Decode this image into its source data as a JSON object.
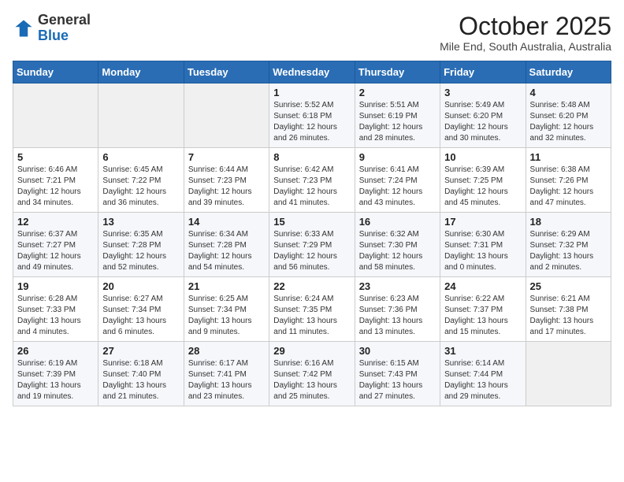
{
  "logo": {
    "general": "General",
    "blue": "Blue"
  },
  "header": {
    "month": "October 2025",
    "location": "Mile End, South Australia, Australia"
  },
  "weekdays": [
    "Sunday",
    "Monday",
    "Tuesday",
    "Wednesday",
    "Thursday",
    "Friday",
    "Saturday"
  ],
  "weeks": [
    [
      {
        "day": "",
        "info": ""
      },
      {
        "day": "",
        "info": ""
      },
      {
        "day": "",
        "info": ""
      },
      {
        "day": "1",
        "info": "Sunrise: 5:52 AM\nSunset: 6:18 PM\nDaylight: 12 hours\nand 26 minutes."
      },
      {
        "day": "2",
        "info": "Sunrise: 5:51 AM\nSunset: 6:19 PM\nDaylight: 12 hours\nand 28 minutes."
      },
      {
        "day": "3",
        "info": "Sunrise: 5:49 AM\nSunset: 6:20 PM\nDaylight: 12 hours\nand 30 minutes."
      },
      {
        "day": "4",
        "info": "Sunrise: 5:48 AM\nSunset: 6:20 PM\nDaylight: 12 hours\nand 32 minutes."
      }
    ],
    [
      {
        "day": "5",
        "info": "Sunrise: 6:46 AM\nSunset: 7:21 PM\nDaylight: 12 hours\nand 34 minutes."
      },
      {
        "day": "6",
        "info": "Sunrise: 6:45 AM\nSunset: 7:22 PM\nDaylight: 12 hours\nand 36 minutes."
      },
      {
        "day": "7",
        "info": "Sunrise: 6:44 AM\nSunset: 7:23 PM\nDaylight: 12 hours\nand 39 minutes."
      },
      {
        "day": "8",
        "info": "Sunrise: 6:42 AM\nSunset: 7:23 PM\nDaylight: 12 hours\nand 41 minutes."
      },
      {
        "day": "9",
        "info": "Sunrise: 6:41 AM\nSunset: 7:24 PM\nDaylight: 12 hours\nand 43 minutes."
      },
      {
        "day": "10",
        "info": "Sunrise: 6:39 AM\nSunset: 7:25 PM\nDaylight: 12 hours\nand 45 minutes."
      },
      {
        "day": "11",
        "info": "Sunrise: 6:38 AM\nSunset: 7:26 PM\nDaylight: 12 hours\nand 47 minutes."
      }
    ],
    [
      {
        "day": "12",
        "info": "Sunrise: 6:37 AM\nSunset: 7:27 PM\nDaylight: 12 hours\nand 49 minutes."
      },
      {
        "day": "13",
        "info": "Sunrise: 6:35 AM\nSunset: 7:28 PM\nDaylight: 12 hours\nand 52 minutes."
      },
      {
        "day": "14",
        "info": "Sunrise: 6:34 AM\nSunset: 7:28 PM\nDaylight: 12 hours\nand 54 minutes."
      },
      {
        "day": "15",
        "info": "Sunrise: 6:33 AM\nSunset: 7:29 PM\nDaylight: 12 hours\nand 56 minutes."
      },
      {
        "day": "16",
        "info": "Sunrise: 6:32 AM\nSunset: 7:30 PM\nDaylight: 12 hours\nand 58 minutes."
      },
      {
        "day": "17",
        "info": "Sunrise: 6:30 AM\nSunset: 7:31 PM\nDaylight: 13 hours\nand 0 minutes."
      },
      {
        "day": "18",
        "info": "Sunrise: 6:29 AM\nSunset: 7:32 PM\nDaylight: 13 hours\nand 2 minutes."
      }
    ],
    [
      {
        "day": "19",
        "info": "Sunrise: 6:28 AM\nSunset: 7:33 PM\nDaylight: 13 hours\nand 4 minutes."
      },
      {
        "day": "20",
        "info": "Sunrise: 6:27 AM\nSunset: 7:34 PM\nDaylight: 13 hours\nand 6 minutes."
      },
      {
        "day": "21",
        "info": "Sunrise: 6:25 AM\nSunset: 7:34 PM\nDaylight: 13 hours\nand 9 minutes."
      },
      {
        "day": "22",
        "info": "Sunrise: 6:24 AM\nSunset: 7:35 PM\nDaylight: 13 hours\nand 11 minutes."
      },
      {
        "day": "23",
        "info": "Sunrise: 6:23 AM\nSunset: 7:36 PM\nDaylight: 13 hours\nand 13 minutes."
      },
      {
        "day": "24",
        "info": "Sunrise: 6:22 AM\nSunset: 7:37 PM\nDaylight: 13 hours\nand 15 minutes."
      },
      {
        "day": "25",
        "info": "Sunrise: 6:21 AM\nSunset: 7:38 PM\nDaylight: 13 hours\nand 17 minutes."
      }
    ],
    [
      {
        "day": "26",
        "info": "Sunrise: 6:19 AM\nSunset: 7:39 PM\nDaylight: 13 hours\nand 19 minutes."
      },
      {
        "day": "27",
        "info": "Sunrise: 6:18 AM\nSunset: 7:40 PM\nDaylight: 13 hours\nand 21 minutes."
      },
      {
        "day": "28",
        "info": "Sunrise: 6:17 AM\nSunset: 7:41 PM\nDaylight: 13 hours\nand 23 minutes."
      },
      {
        "day": "29",
        "info": "Sunrise: 6:16 AM\nSunset: 7:42 PM\nDaylight: 13 hours\nand 25 minutes."
      },
      {
        "day": "30",
        "info": "Sunrise: 6:15 AM\nSunset: 7:43 PM\nDaylight: 13 hours\nand 27 minutes."
      },
      {
        "day": "31",
        "info": "Sunrise: 6:14 AM\nSunset: 7:44 PM\nDaylight: 13 hours\nand 29 minutes."
      },
      {
        "day": "",
        "info": ""
      }
    ]
  ]
}
